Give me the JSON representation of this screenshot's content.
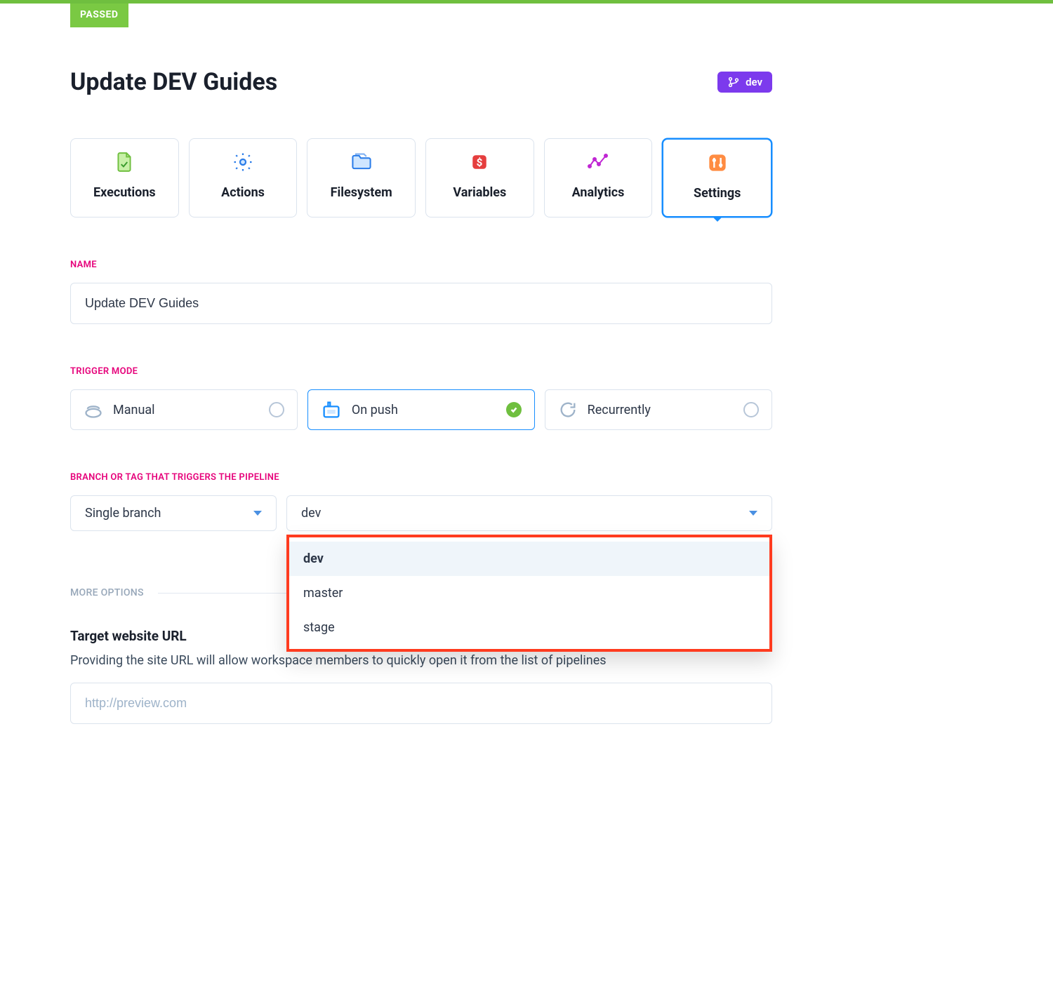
{
  "status": {
    "label": "PASSED"
  },
  "header": {
    "title": "Update DEV Guides",
    "branch_chip": "dev"
  },
  "tabs": [
    {
      "label": "Executions"
    },
    {
      "label": "Actions"
    },
    {
      "label": "Filesystem"
    },
    {
      "label": "Variables"
    },
    {
      "label": "Analytics"
    },
    {
      "label": "Settings"
    }
  ],
  "name": {
    "section_label": "NAME",
    "value": "Update DEV Guides"
  },
  "trigger": {
    "section_label": "TRIGGER MODE",
    "options": {
      "manual": "Manual",
      "on_push": "On push",
      "recurrently": "Recurrently"
    }
  },
  "branch": {
    "section_label": "BRANCH OR TAG THAT TRIGGERS THE PIPELINE",
    "mode": "Single branch",
    "selected": "dev",
    "options": [
      "dev",
      "master",
      "stage"
    ]
  },
  "more": {
    "label": "MORE OPTIONS",
    "target_title": "Target website URL",
    "target_desc": "Providing the site URL will allow workspace members to quickly open it from the list of pipelines",
    "target_placeholder": "http://preview.com"
  }
}
